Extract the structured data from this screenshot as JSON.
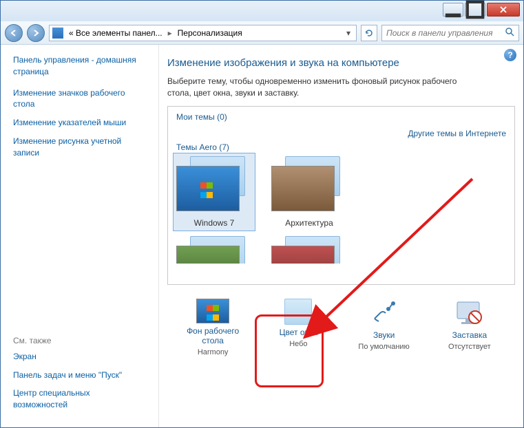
{
  "breadcrumb": {
    "seg1": "« Все элементы панел...",
    "seg2": "Персонализация"
  },
  "search": {
    "placeholder": "Поиск в панели управления"
  },
  "sidebar": {
    "home": "Панель управления - домашняя страница",
    "links": [
      "Изменение значков рабочего стола",
      "Изменение указателей мыши",
      "Изменение рисунка учетной записи"
    ],
    "see_also_label": "См. также",
    "see_also": [
      "Экран",
      "Панель задач и меню \"Пуск\"",
      "Центр специальных возможностей"
    ]
  },
  "main": {
    "title": "Изменение изображения и звука на компьютере",
    "subtitle": "Выберите тему, чтобы одновременно изменить фоновый рисунок рабочего стола, цвет окна, звуки и заставку.",
    "my_themes_label": "Мои темы (0)",
    "online_link": "Другие темы в Интернете",
    "aero_label": "Темы Aero (7)",
    "themes": [
      {
        "label": "Windows 7"
      },
      {
        "label": "Архитектура"
      }
    ],
    "bottom": {
      "bg": {
        "label": "Фон рабочего стола",
        "sub": "Harmony"
      },
      "wc": {
        "label": "Цвет окна",
        "sub": "Небо"
      },
      "snd": {
        "label": "Звуки",
        "sub": "По умолчанию"
      },
      "ss": {
        "label": "Заставка",
        "sub": "Отсутствует"
      }
    },
    "help": "?"
  }
}
